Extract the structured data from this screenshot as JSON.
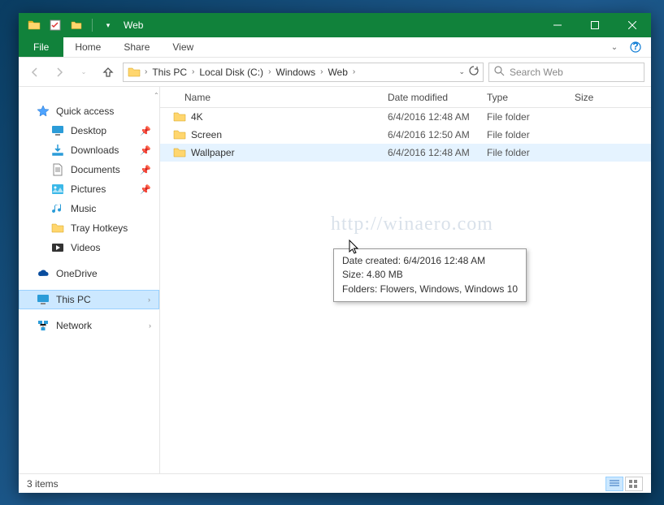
{
  "window": {
    "title": "Web"
  },
  "ribbon": {
    "file": "File",
    "tabs": [
      "Home",
      "Share",
      "View"
    ]
  },
  "breadcrumb": {
    "segments": [
      "This PC",
      "Local Disk (C:)",
      "Windows",
      "Web"
    ]
  },
  "search": {
    "placeholder": "Search Web"
  },
  "sidebar": {
    "quick_access": "Quick access",
    "quick_items": [
      {
        "label": "Desktop",
        "icon": "desktop",
        "pinned": true
      },
      {
        "label": "Downloads",
        "icon": "downloads",
        "pinned": true
      },
      {
        "label": "Documents",
        "icon": "documents",
        "pinned": true
      },
      {
        "label": "Pictures",
        "icon": "pictures",
        "pinned": true
      },
      {
        "label": "Music",
        "icon": "music",
        "pinned": false
      },
      {
        "label": "Tray Hotkeys",
        "icon": "folder",
        "pinned": false
      },
      {
        "label": "Videos",
        "icon": "videos",
        "pinned": false
      }
    ],
    "onedrive": "OneDrive",
    "this_pc": "This PC",
    "network": "Network"
  },
  "columns": {
    "name": "Name",
    "date": "Date modified",
    "type": "Type",
    "size": "Size"
  },
  "rows": [
    {
      "name": "4K",
      "date": "6/4/2016 12:48 AM",
      "type": "File folder"
    },
    {
      "name": "Screen",
      "date": "6/4/2016 12:50 AM",
      "type": "File folder"
    },
    {
      "name": "Wallpaper",
      "date": "6/4/2016 12:48 AM",
      "type": "File folder"
    }
  ],
  "tooltip": {
    "line1": "Date created: 6/4/2016 12:48 AM",
    "line2": "Size: 4.80 MB",
    "line3": "Folders: Flowers, Windows, Windows 10"
  },
  "status": {
    "text": "3 items"
  },
  "watermark": "http://winaero.com"
}
